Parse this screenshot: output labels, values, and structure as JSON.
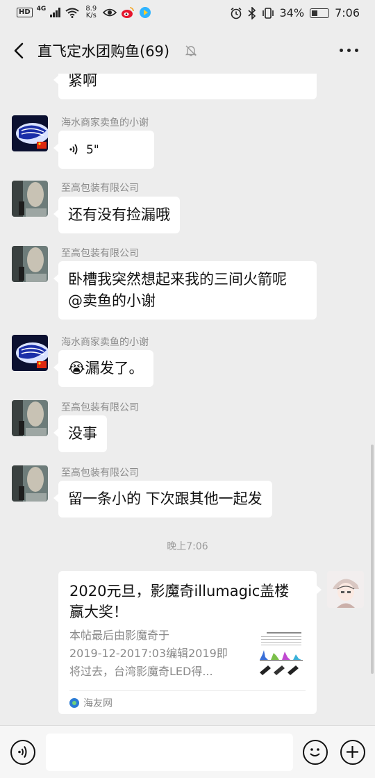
{
  "status_bar": {
    "left_badge": "HD",
    "network": "4G",
    "speed_value": "8.9",
    "speed_unit": "K/s",
    "battery": "34%",
    "time": "7:06"
  },
  "header": {
    "title": "直飞定水团购鱼(69)"
  },
  "messages": [
    {
      "sender": "",
      "text": "紧啊"
    },
    {
      "sender": "海水商家卖鱼的小谢",
      "voice_duration": "5\""
    },
    {
      "sender": "至高包装有限公司",
      "text": "还有没有捡漏哦"
    },
    {
      "sender": "至高包装有限公司",
      "line1": "卧槽我突然想起来我的三间火箭呢",
      "line2": "@卖鱼的小谢"
    },
    {
      "sender": "海水商家卖鱼的小谢",
      "emoji": "😭",
      "text": "漏发了。"
    },
    {
      "sender": "至高包装有限公司",
      "text": "没事"
    },
    {
      "sender": "至高包装有限公司",
      "text": "留一条小的 下次跟其他一起发"
    }
  ],
  "timestamp": "晚上7:06",
  "link_card": {
    "title_line1": "2020元旦，影魔奇illumagic盖楼",
    "title_line2": "赢大奖！",
    "desc_line1": "本帖最后由影魔奇于",
    "desc_line2": "2019-12-2017:03编辑2019即",
    "desc_line3": "将过去，台湾影魔奇LED得...",
    "source": "海友网"
  },
  "icons": {
    "back": "chevron-left-icon",
    "mute": "bell-off-icon",
    "more": "more-horizontal-icon",
    "voice_input": "voice-icon",
    "emoji": "emoji-icon",
    "add": "plus-icon"
  },
  "colors": {
    "background": "#ededed",
    "bubble": "#ffffff",
    "muted_text": "#8a8a8a"
  }
}
